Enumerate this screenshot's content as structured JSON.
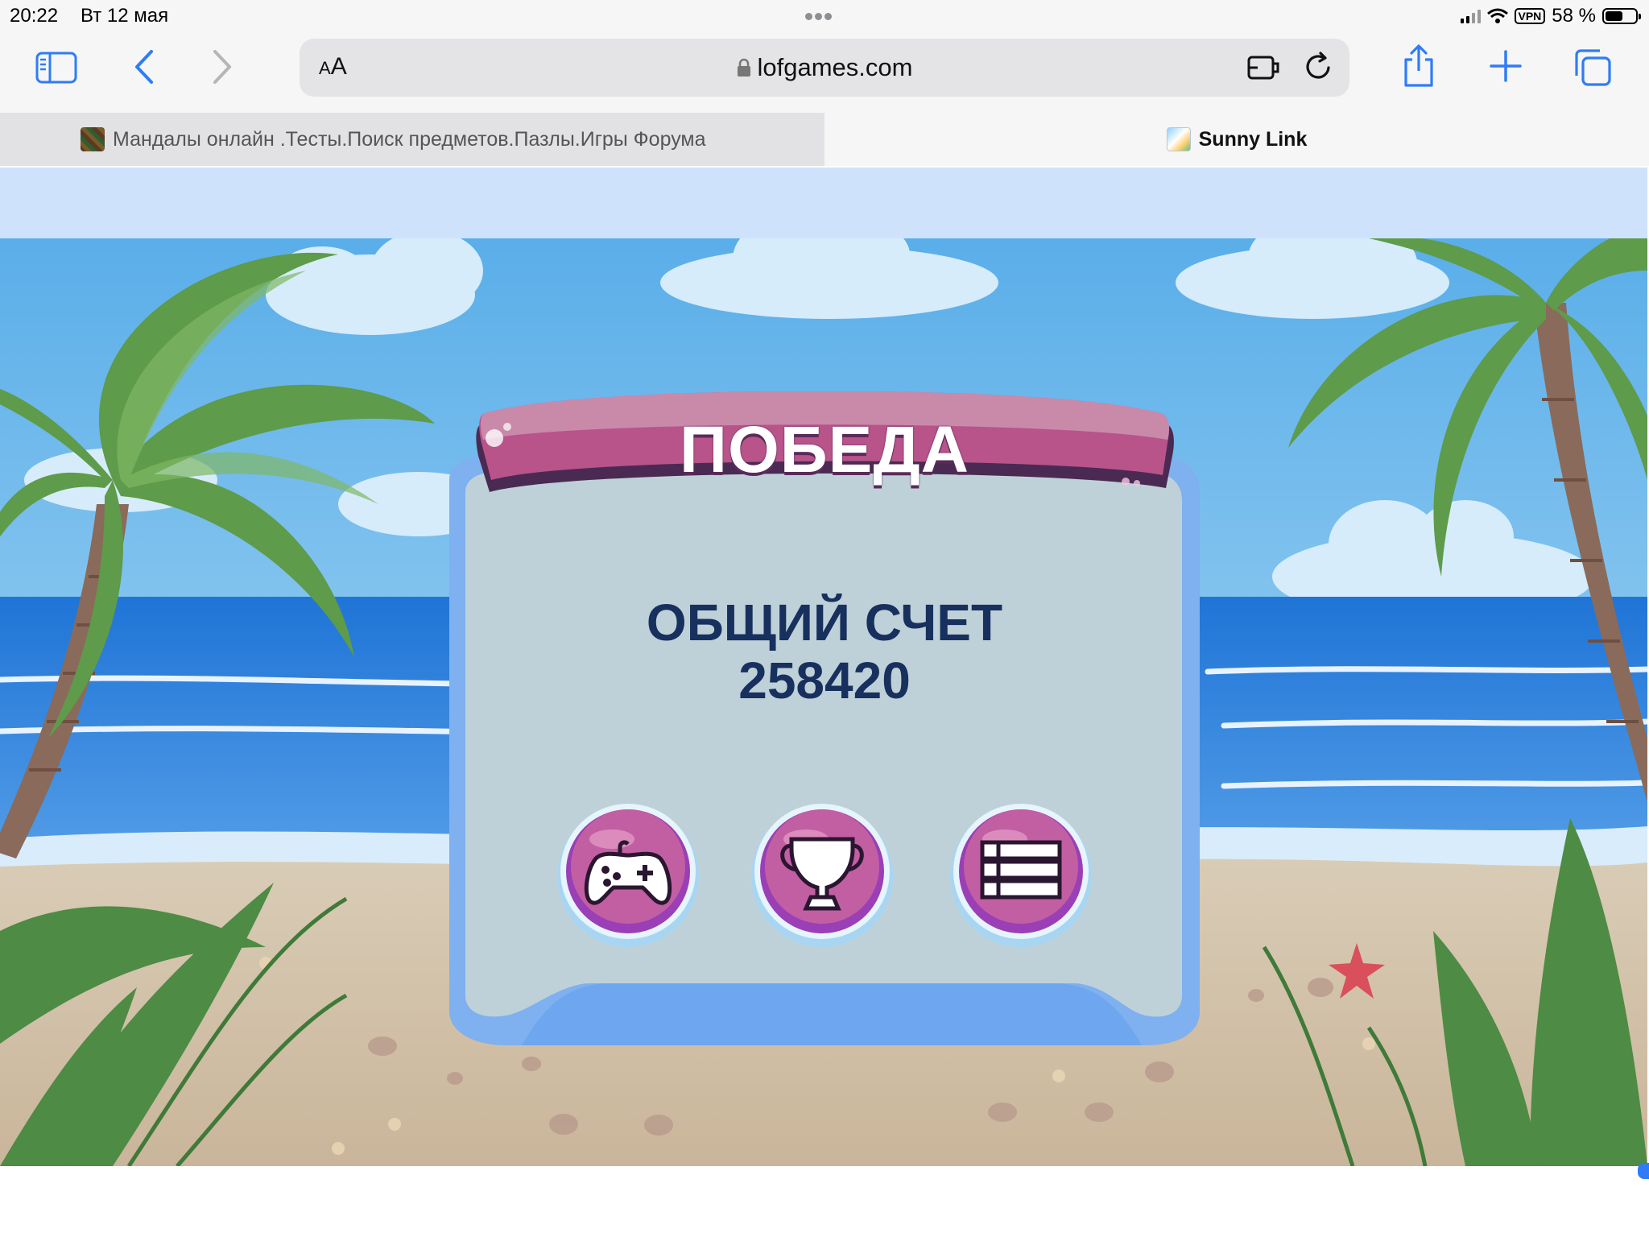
{
  "status_bar": {
    "time": "20:22",
    "date": "Вт 12 мая",
    "vpn": "VPN",
    "battery_text": "58 %",
    "battery_level": 0.58
  },
  "toolbar": {
    "text_size_label": "AA",
    "url": "lofgames.com",
    "icons": [
      "sidebar-icon",
      "back-icon",
      "forward-icon",
      "lock-icon",
      "extension-icon",
      "reload-icon",
      "share-icon",
      "plus-icon",
      "tabs-icon"
    ],
    "accent_color": "#2f7cf6"
  },
  "tabs": [
    {
      "title": "Мандалы онлайн .Тесты.Поиск предметов.Пазлы.Игры Форума",
      "active": false
    },
    {
      "title": "Sunny Link",
      "active": true
    }
  ],
  "game": {
    "dialog_title": "ПОБЕДА",
    "score_label": "ОБЩИЙ СЧЕТ",
    "score_value": "258420",
    "buttons": [
      "gamepad-icon",
      "trophy-icon",
      "list-icon"
    ]
  }
}
